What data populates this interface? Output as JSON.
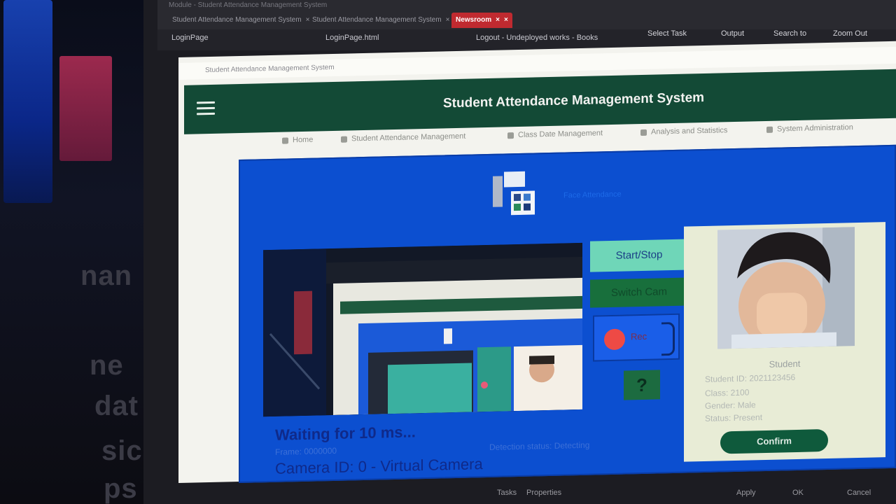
{
  "background_text": [
    "nan",
    "ne",
    "dat",
    "sic",
    "ps"
  ],
  "browser": {
    "title_fragment": "Module - Student Attendance Management System",
    "tabs": [
      {
        "label": "Student Attendance Management System",
        "active": false
      },
      {
        "label": "Student Attendance Management System",
        "active": false
      },
      {
        "label": "Newsroom",
        "active": true
      }
    ],
    "bookmarks": [
      "LoginPage",
      "LoginPage.html",
      "Logout - Undeployed works - Books"
    ],
    "tools": [
      "Select Task",
      "Output",
      "Search to",
      "Zoom Out"
    ],
    "address_text": "Student Attendance Management System",
    "colors": {
      "tab_active": "#c02a30"
    }
  },
  "header": {
    "title": "Student Attendance Management System",
    "menu_icon": "hamburger-menu-icon",
    "color": "#134a36"
  },
  "nav": {
    "items": [
      {
        "label": "Home",
        "icon": "home-icon"
      },
      {
        "label": "Student Attendance Management",
        "icon": "user-icon"
      },
      {
        "label": "Class Date Management",
        "icon": "calendar-icon"
      },
      {
        "label": "Analysis and Statistics",
        "icon": "chart-icon"
      },
      {
        "label": "System Administration",
        "icon": "shield-icon"
      }
    ]
  },
  "panel": {
    "logo_label": "Face Attendance",
    "buttons": {
      "start_stop": "Start/Stop",
      "switch_cam": "Switch Cam",
      "record_label": "Rec",
      "help": "?"
    },
    "status": {
      "waiting": "Waiting for 10 ms...",
      "frame_label": "Frame: 0000000",
      "fps_label": "Detection status: Detecting",
      "camera": "Camera ID: 0 - Virtual Camera"
    },
    "colors": {
      "panel": "#0c4fd0",
      "start_btn": "#6fd6b8",
      "switch_btn": "#186f3c",
      "record_dot": "#ee4a45"
    }
  },
  "card": {
    "name": "Student",
    "lines": [
      "Student ID: 2021123456",
      "Class: 2100",
      "Gender: Male",
      "Status: Present"
    ],
    "button": "Confirm"
  },
  "taskbar": {
    "items": [
      "Tasks",
      "Properties",
      "Apply",
      "OK",
      "Cancel"
    ]
  }
}
